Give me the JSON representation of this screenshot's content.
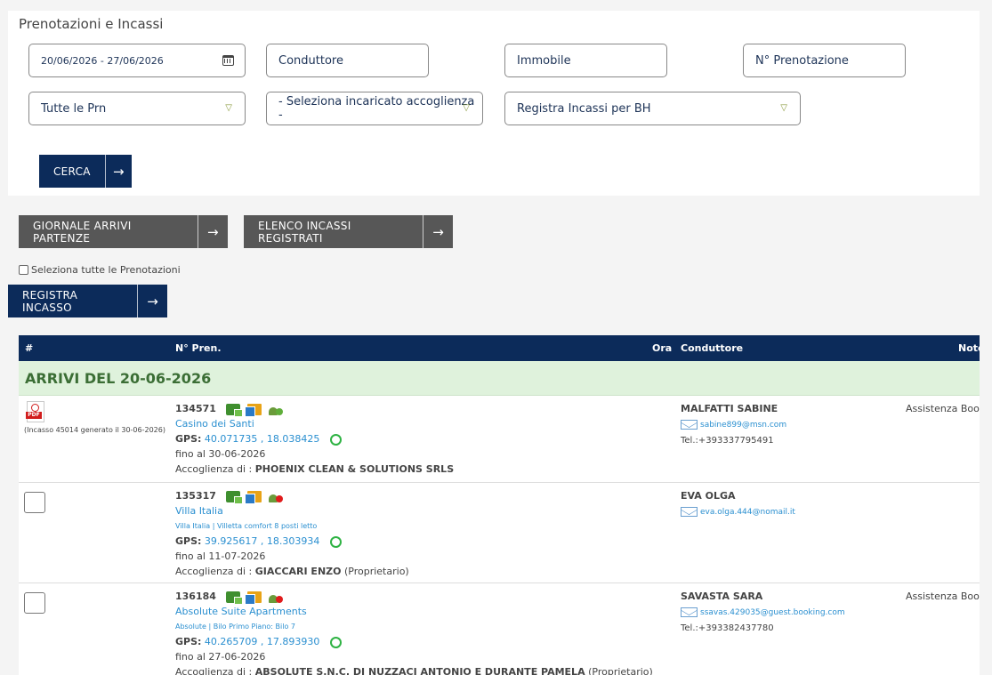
{
  "panel": {
    "title": "Prenotazioni e Incassi",
    "date_range": "20/06/2026 - 27/06/2026",
    "conduttore_placeholder": "Conduttore",
    "immobile_placeholder": "Immobile",
    "prenotazione_placeholder": "N° Prenotazione",
    "filter_prn": "Tutte le Prn",
    "filter_incaricato": "- Seleziona incaricato accoglienza -",
    "filter_registra": "Registra Incassi per BH",
    "search_label": "CERCA"
  },
  "actions": {
    "giornale_label": "GIORNALE ARRIVI PARTENZE",
    "elenco_label": "ELENCO INCASSI REGISTRATI",
    "select_all_label": "Seleziona tutte le Prenotazioni",
    "registra_label": "REGISTRA INCASSO"
  },
  "icons": {
    "arrow": "→",
    "dropdown": "▽"
  },
  "table": {
    "headers": {
      "hash": "#",
      "pren": "N° Pren.",
      "ora": "Ora",
      "conduttore": "Conduttore",
      "note": "Note"
    },
    "group_title": "ARRIVI DEL  20-06-2026",
    "rows": [
      {
        "pdf_label": "PDF",
        "pdf_caption": "(Incasso 45014 generato il 30-06-2026)",
        "pren": "134571",
        "property": "Casino dei Santi",
        "unit": "",
        "gps_label": "GPS:",
        "gps_lat": "40.071735",
        "gps_sep": ",",
        "gps_lon": "18.038425",
        "until": "fino al 30-06-2026",
        "acc_label": "Accoglienza di :",
        "acc_name": "PHOENIX CLEAN & SOLUTIONS SRLS",
        "acc_role": "",
        "guest": "MALFATTI SABINE",
        "email": "sabine899@msn.com",
        "tel": "Tel.:+393337795491",
        "note": "Assistenza Bookir"
      },
      {
        "pren": "135317",
        "property": "Villa Italia",
        "unit": "Villa Italia | Villetta comfort 8 posti letto",
        "gps_label": "GPS:",
        "gps_lat": "39.925617",
        "gps_sep": ",",
        "gps_lon": "18.303934",
        "until": "fino al 11-07-2026",
        "acc_label": "Accoglienza di :",
        "acc_name": "GIACCARI ENZO",
        "acc_role": "(Proprietario)",
        "guest": "EVA OLGA",
        "email": "eva.olga.444@nomail.it",
        "tel": "",
        "note": ""
      },
      {
        "pren": "136184",
        "property": "Absolute Suite Apartments",
        "unit": "Absolute | Bilo Primo Piano: Bilo 7",
        "gps_label": "GPS:",
        "gps_lat": "40.265709",
        "gps_sep": ",",
        "gps_lon": "17.893930",
        "until": "fino al 27-06-2026",
        "acc_label": "Accoglienza di :",
        "acc_name": "ABSOLUTE S.N.C. DI NUZZACI ANTONIO E DURANTE PAMELA",
        "acc_role": "(Proprietario)",
        "guest": "SAVASTA SARA",
        "email": "ssavas.429035@guest.booking.com",
        "tel": "Tel.:+393382437780",
        "note": "Assistenza Bookir"
      }
    ]
  }
}
